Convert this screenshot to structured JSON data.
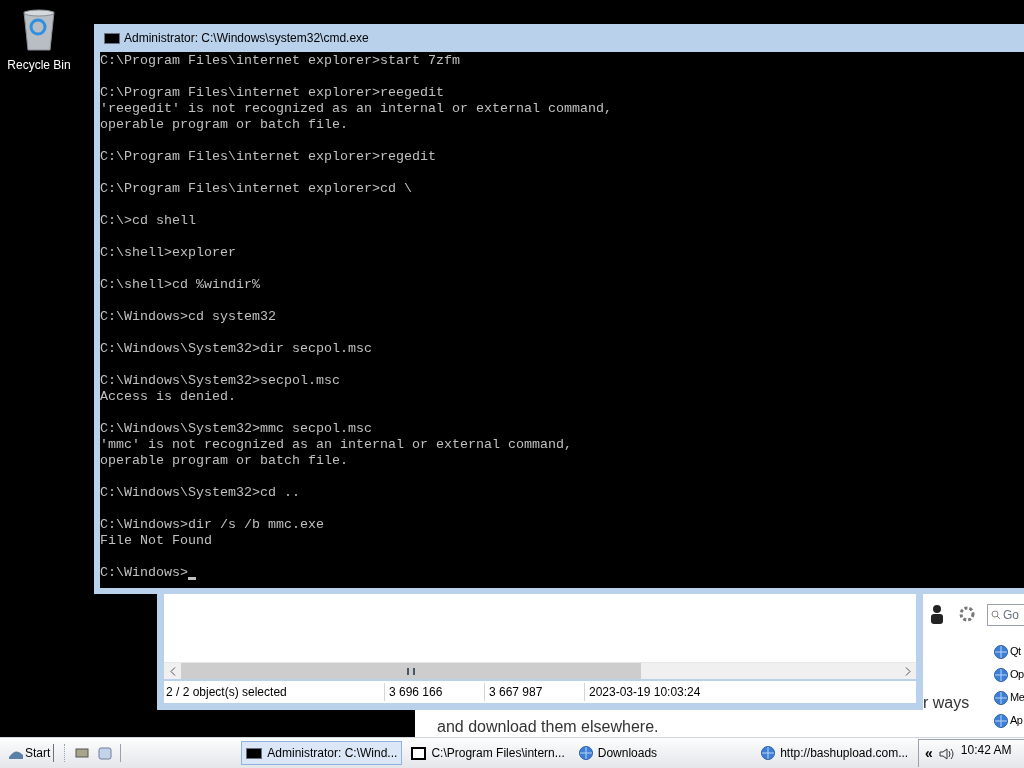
{
  "desktop_icons": [
    {
      "label": "Recycle Bin"
    }
  ],
  "console": {
    "title": "Administrator: C:\\Windows\\system32\\cmd.exe",
    "blocks": [
      [
        "C:\\Program Files\\internet explorer>start 7zfm"
      ],
      [
        "C:\\Program Files\\internet explorer>reegedit",
        "'reegedit' is not recognized as an internal or external command,",
        "operable program or batch file."
      ],
      [
        "C:\\Program Files\\internet explorer>regedit"
      ],
      [
        "C:\\Program Files\\internet explorer>cd \\"
      ],
      [
        "C:\\>cd shell"
      ],
      [
        "C:\\shell>explorer"
      ],
      [
        "C:\\shell>cd %windir%"
      ],
      [
        "C:\\Windows>cd system32"
      ],
      [
        "C:\\Windows\\System32>dir secpol.msc"
      ],
      [
        "C:\\Windows\\System32>secpol.msc",
        "Access is denied."
      ],
      [
        "C:\\Windows\\System32>mmc secpol.msc",
        "'mmc' is not recognized as an internal or external command,",
        "operable program or batch file."
      ],
      [
        "C:\\Windows\\System32>cd .."
      ],
      [
        "C:\\Windows>dir /s /b mmc.exe",
        "File Not Found"
      ],
      [
        "C:\\Windows>"
      ]
    ],
    "cursor": true
  },
  "file_manager": {
    "status_bar": [
      "2 / 2 object(s) selected",
      "3 696 166",
      "3 667 987",
      "2023-03-19 10:03:24"
    ]
  },
  "browser": {
    "search": {
      "placeholder": "Go"
    },
    "text_lines": [
      "r ways",
      "and download them elsewhere."
    ],
    "links": [
      "Qt",
      "Op",
      "Me",
      "Ap"
    ]
  },
  "taskbar": {
    "start": "Start",
    "tasks": [
      {
        "label": "Administrator: C:\\Wind...",
        "selected": true,
        "kind": "console"
      },
      {
        "label": "C:\\Program Files\\intern...",
        "selected": false,
        "kind": "archive"
      },
      {
        "label": "Downloads",
        "selected": false,
        "kind": "browser"
      },
      {
        "label": "http://bashupload.com...",
        "selected": false,
        "kind": "browser"
      }
    ],
    "tray_expand": "«",
    "clock": "10:42 AM"
  }
}
